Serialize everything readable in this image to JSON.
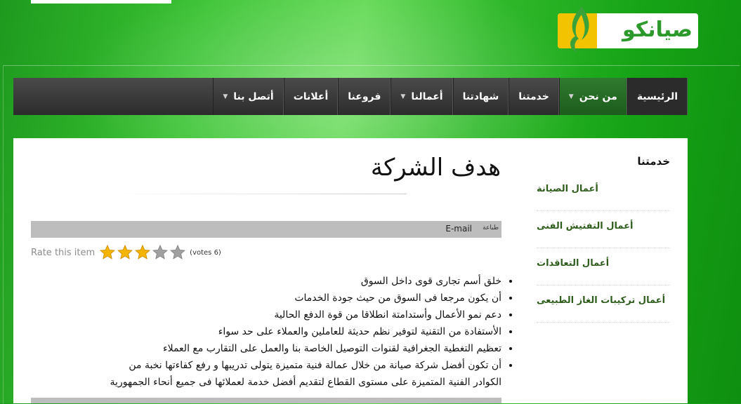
{
  "logo": {
    "text": "صيانكو"
  },
  "nav": {
    "items": [
      {
        "label": "الرئيسية",
        "dropdown": false,
        "state": "home"
      },
      {
        "label": "من نحن",
        "dropdown": true,
        "state": "active"
      },
      {
        "label": "خدمتنا",
        "dropdown": false,
        "state": ""
      },
      {
        "label": "شهادتنا",
        "dropdown": false,
        "state": ""
      },
      {
        "label": "أعمالنا",
        "dropdown": true,
        "state": ""
      },
      {
        "label": "فروعنا",
        "dropdown": false,
        "state": ""
      },
      {
        "label": "أعلانات",
        "dropdown": false,
        "state": ""
      },
      {
        "label": "أتصل بنا",
        "dropdown": true,
        "state": ""
      }
    ],
    "caret_icon": "▼"
  },
  "sidebar": {
    "title": "خدمتنا",
    "items": [
      "أعمال الصيانة",
      "أعمال التفتيش الفنى",
      "أعمال التعاقدات",
      "أعمال تركيبات الغاز الطبيعى"
    ]
  },
  "article": {
    "title": "هدف الشركة",
    "print_label": "طباعة",
    "email_label": "E-mail",
    "rating": {
      "label": "Rate this item",
      "value": 3,
      "max": 5,
      "votes_text": "(votes 6)"
    },
    "goals": [
      "خلق أسم تجارى قوى داخل السوق",
      "أن يكون مرجعا فى السوق من حيث جودة الخدمات",
      "دعم نمو الأعمال وأستدامتة انطلاقا من قوة الدفع الحالية",
      "الأستفادة من التقنية لتوفير نظم حديثة للعاملين والعملاء على حد سواء",
      "تعظيم التغطية الجغرافية لقنوات التوصيل الخاصة بنا والعمل على التقارب مع العملاء",
      "أن تكون أفضل شركة صيانة من خلال عمالة فنية متميزة يتولى تدريبها و رفع كفاءتها نخبة من الكوادر الفنية المتميزة على مستوى القطاع لتقديم أفضل خدمة لعملائها فى جميع أنحاء الجمهورية"
    ]
  },
  "colors": {
    "accent_green": "#2f7a2f",
    "link_green": "#2f5d1c",
    "logo_yellow": "#f2c300",
    "star_gold": "#f5b400",
    "star_gray": "#a0a0a0"
  }
}
